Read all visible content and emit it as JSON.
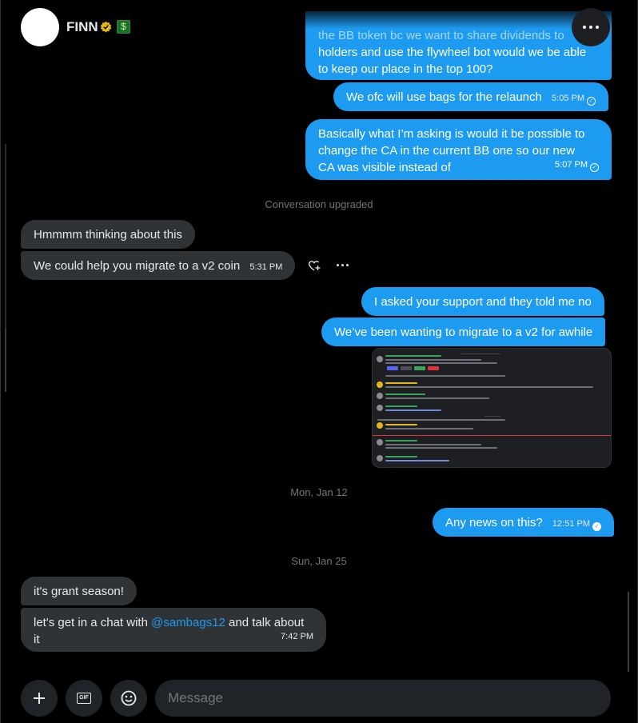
{
  "header": {
    "name": "FINN"
  },
  "messages_top": {
    "partial_text_line1": "the BB token bc we want to share dividends to",
    "partial_text_line2": "holders and use the flywheel bot would we be able",
    "partial_text_line3": "to keep our place in the top 100?",
    "relaunch_text": "We ofc will use bags for the relaunch",
    "relaunch_time": "5:05 PM",
    "ca_line1": "Basically what I’m asking is would it be possible to",
    "ca_line2": "change the CA in the current BB one so our new",
    "ca_line3": "CA was visible instead of",
    "ca_time": "5:07 PM"
  },
  "system": {
    "upgraded": "Conversation upgraded"
  },
  "recv1": {
    "text": "Hmmmm thinking about this",
    "text2": "We could help you migrate to a v2 coin",
    "time2": "5:31 PM"
  },
  "sent2": {
    "support": "I asked your support and they told me no",
    "migrate": "We’ve been wanting to migrate to a v2 for awhile"
  },
  "dates": {
    "d1": "Mon, Jan 12",
    "d2": "Sun, Jan 25"
  },
  "sent3": {
    "text": "Any news on this?",
    "time": "12:51 PM"
  },
  "recv2": {
    "text": "it's grant season!",
    "text2a": "let's get in a chat with ",
    "mention": "@sambags12",
    "text2b": " and talk about",
    "text2c": "it",
    "time": "7:42 PM"
  },
  "composer": {
    "placeholder": "Message",
    "gif_label": "GIF"
  },
  "colors": {
    "accent": "#1d9bf0",
    "received_bubble": "#2f3336",
    "background": "#000000"
  },
  "icons": [
    "verified-badge-icon",
    "money-bag-icon",
    "more-icon",
    "add-reaction-icon",
    "plus-icon",
    "gif-icon",
    "emoji-icon"
  ]
}
